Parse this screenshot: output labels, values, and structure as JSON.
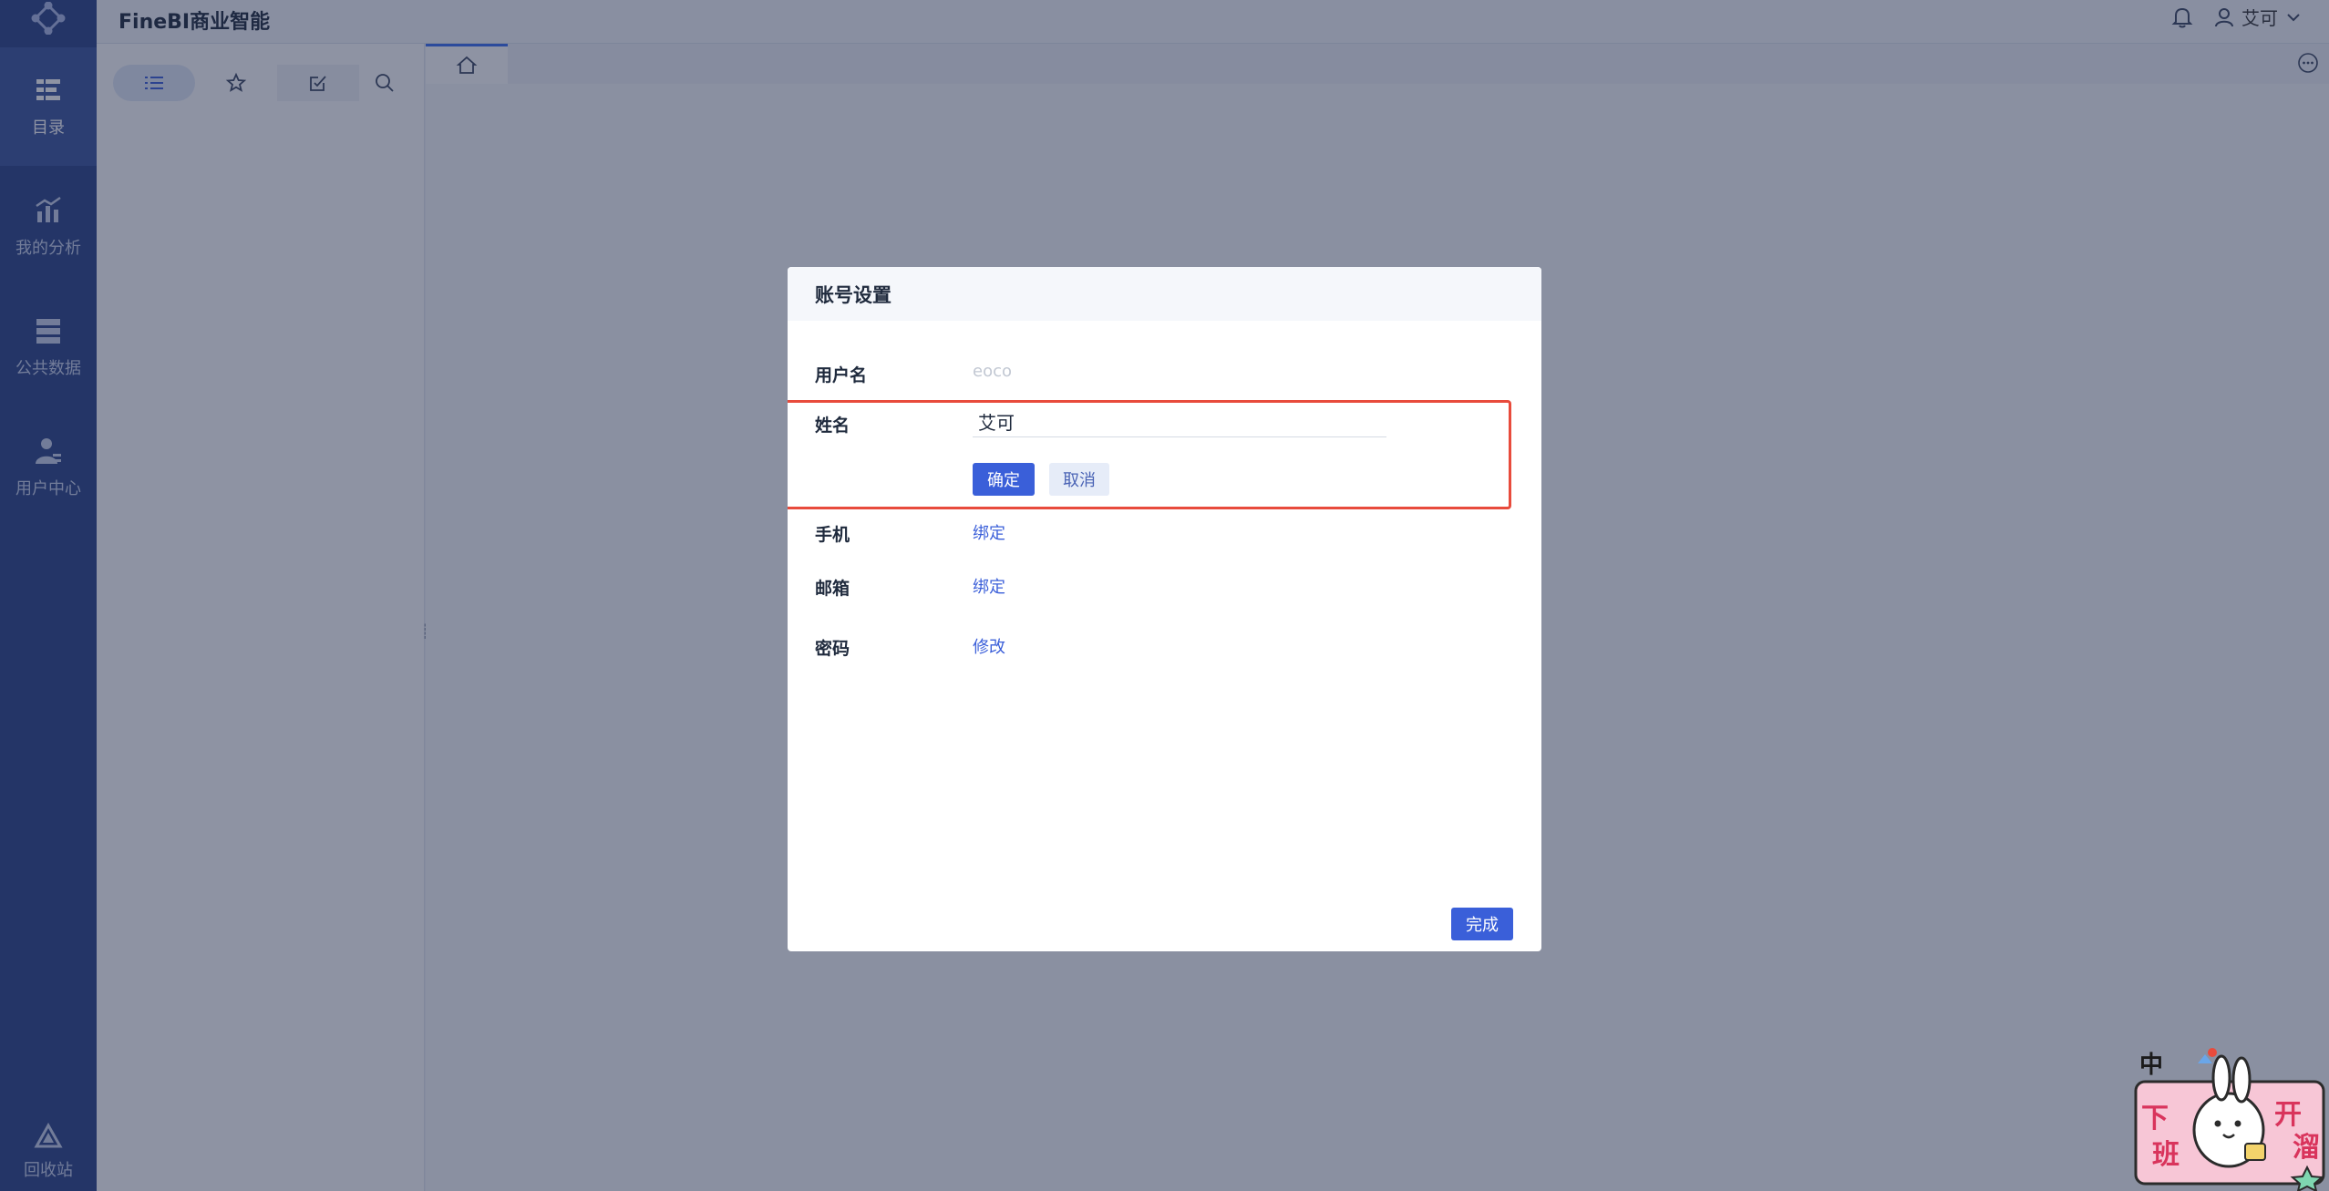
{
  "app": {
    "title": "FineBI商业智能"
  },
  "header": {
    "user_name": "艾可"
  },
  "nav": {
    "items": [
      {
        "label": "目录",
        "icon": "catalog-icon",
        "active": true
      },
      {
        "label": "我的分析",
        "icon": "analysis-icon",
        "active": false
      },
      {
        "label": "公共数据",
        "icon": "public-data-icon",
        "active": false
      },
      {
        "label": "用户中心",
        "icon": "user-center-icon",
        "active": false
      }
    ],
    "recycle_label": "回收站"
  },
  "subpanel": {
    "tabs": [
      {
        "icon": "list-icon",
        "active": true
      },
      {
        "icon": "star-icon",
        "active": false
      },
      {
        "icon": "checked-square-icon",
        "active": false
      },
      {
        "icon": "search-icon",
        "active": false
      }
    ]
  },
  "dialog": {
    "title": "账号设置",
    "username_label": "用户名",
    "username_value": "eoco",
    "name_label": "姓名",
    "name_value": "艾可",
    "confirm_label": "确定",
    "cancel_label": "取消",
    "phone_label": "手机",
    "phone_action": "绑定",
    "email_label": "邮箱",
    "email_action": "绑定",
    "password_label": "密码",
    "password_action": "修改",
    "done_label": "完成"
  },
  "sticker": {
    "chars": [
      "中",
      "下",
      "班",
      "开",
      "溜"
    ]
  },
  "colors": {
    "nav_bg": "#2a4387",
    "accent": "#3a5fd9",
    "highlight": "#e84b3c",
    "overlay": "rgba(29,40,72,0.50)"
  }
}
